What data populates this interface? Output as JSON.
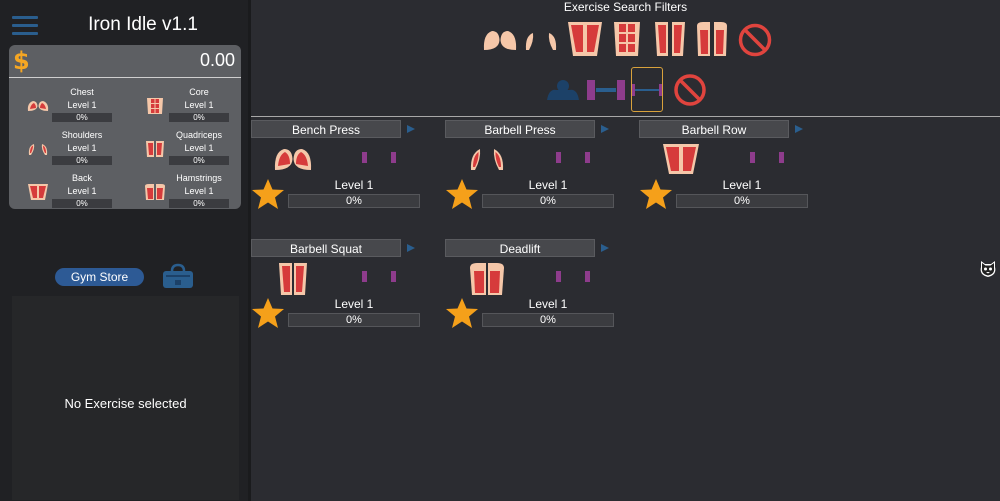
{
  "app": {
    "title": "Iron Idle v1.1"
  },
  "wallet": {
    "currency_symbol": "$",
    "money": "0.00"
  },
  "muscles": [
    {
      "name": "Chest",
      "level": "Level 1",
      "progress": "0%",
      "icon": "chest-icon"
    },
    {
      "name": "Core",
      "level": "Level 1",
      "progress": "0%",
      "icon": "core-icon"
    },
    {
      "name": "Shoulders",
      "level": "Level 1",
      "progress": "0%",
      "icon": "shoulders-icon"
    },
    {
      "name": "Quadriceps",
      "level": "Level 1",
      "progress": "0%",
      "icon": "quadriceps-icon"
    },
    {
      "name": "Back",
      "level": "Level 1",
      "progress": "0%",
      "icon": "back-icon"
    },
    {
      "name": "Hamstrings",
      "level": "Level 1",
      "progress": "0%",
      "icon": "hamstrings-icon"
    }
  ],
  "store": {
    "label": "Gym Store"
  },
  "exercise_panel": {
    "empty_text": "No Exercise selected"
  },
  "filters": {
    "title": "Exercise Search Filters"
  },
  "exercises": [
    {
      "name": "Bench Press",
      "level": "Level 1",
      "progress": "0%"
    },
    {
      "name": "Barbell Press",
      "level": "Level 1",
      "progress": "0%"
    },
    {
      "name": "Barbell Row",
      "level": "Level 1",
      "progress": "0%"
    },
    {
      "name": "Barbell Squat",
      "level": "Level 1",
      "progress": "0%"
    },
    {
      "name": "Deadlift",
      "level": "Level 1",
      "progress": "0%"
    }
  ],
  "colors": {
    "accent": "#2d5a95",
    "muscle": "#f5c7a9",
    "muscle_active": "#d63b3b",
    "star": "#f5a01a",
    "no_filter": "#e0443e",
    "equipment": "#8e3c8c"
  }
}
